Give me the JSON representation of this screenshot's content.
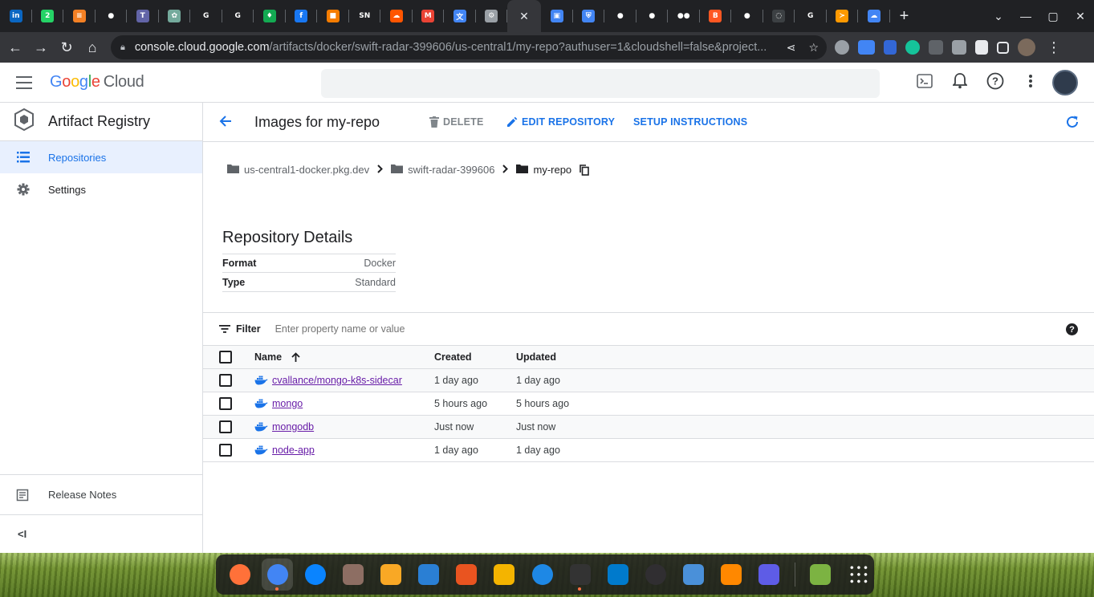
{
  "browser": {
    "tab_favicons": [
      {
        "name": "linkedin",
        "color": "#0a66c2",
        "glyph": "in"
      },
      {
        "name": "whatsapp",
        "color": "#25d366",
        "glyph": "2"
      },
      {
        "name": "stackoverflow",
        "color": "#f48024",
        "glyph": "≡"
      },
      {
        "name": "github",
        "color": "#ffffff",
        "glyph": "●"
      },
      {
        "name": "teams",
        "color": "#6264a7",
        "glyph": "T"
      },
      {
        "name": "chatgpt",
        "color": "#74aa9c",
        "glyph": "✿"
      },
      {
        "name": "google",
        "color": "#ffffff",
        "glyph": "G"
      },
      {
        "name": "google",
        "color": "#ffffff",
        "glyph": "G"
      },
      {
        "name": "mongodb",
        "color": "#13aa52",
        "glyph": "♦"
      },
      {
        "name": "facebook",
        "color": "#1877f2",
        "glyph": "f"
      },
      {
        "name": "package",
        "color": "#f57c00",
        "glyph": "■"
      },
      {
        "name": "sn",
        "color": "#ffffff",
        "glyph": "SN"
      },
      {
        "name": "soundcloud",
        "color": "#ff5500",
        "glyph": "☁"
      },
      {
        "name": "gmail",
        "color": "#ea4335",
        "glyph": "M"
      },
      {
        "name": "translate",
        "color": "#4285f4",
        "glyph": "文"
      },
      {
        "name": "settings",
        "color": "#9aa0a6",
        "glyph": "⚙"
      }
    ],
    "tab_favicons_right": [
      {
        "name": "chip",
        "color": "#4285f4",
        "glyph": "▣"
      },
      {
        "name": "shield",
        "color": "#4285f4",
        "glyph": "⛨"
      },
      {
        "name": "github",
        "color": "#ffffff",
        "glyph": "●"
      },
      {
        "name": "github",
        "color": "#ffffff",
        "glyph": "●"
      },
      {
        "name": "medium",
        "color": "#ffffff",
        "glyph": "●●"
      },
      {
        "name": "blogger",
        "color": "#ff5722",
        "glyph": "B"
      },
      {
        "name": "github",
        "color": "#ffffff",
        "glyph": "●"
      },
      {
        "name": "dark",
        "color": "#3c4043",
        "glyph": "◌"
      },
      {
        "name": "google",
        "color": "#ffffff",
        "glyph": "G"
      },
      {
        "name": "aws",
        "color": "#ff9900",
        "glyph": "≻"
      },
      {
        "name": "gcloud",
        "color": "#4285f4",
        "glyph": "☁"
      }
    ],
    "active_tab_close": "✕",
    "url_domain": "console.cloud.google.com",
    "url_path": "/artifacts/docker/swift-radar-399606/us-central1/my-repo?authuser=1&cloudshell=false&project..."
  },
  "header": {
    "logo_letters": [
      "G",
      "o",
      "o",
      "g",
      "l",
      "e"
    ],
    "logo_suffix": "Cloud"
  },
  "sidenav": {
    "product": "Artifact Registry",
    "items": [
      {
        "label": "Repositories",
        "active": true
      },
      {
        "label": "Settings",
        "active": false
      }
    ],
    "release_notes": "Release Notes",
    "collapse": "<I"
  },
  "page": {
    "title": "Images for my-repo",
    "actions": {
      "delete": "DELETE",
      "edit": "EDIT REPOSITORY",
      "setup": "SETUP INSTRUCTIONS"
    },
    "breadcrumb": [
      {
        "label": "us-central1-docker.pkg.dev"
      },
      {
        "label": "swift-radar-399606"
      },
      {
        "label": "my-repo"
      }
    ],
    "details": {
      "title": "Repository Details",
      "rows": [
        {
          "key": "Format",
          "value": "Docker"
        },
        {
          "key": "Type",
          "value": "Standard"
        }
      ]
    },
    "filter": {
      "label": "Filter",
      "placeholder": "Enter property name or value"
    },
    "table": {
      "headers": {
        "name": "Name",
        "created": "Created",
        "updated": "Updated"
      },
      "sort_indicator": "↑",
      "rows": [
        {
          "name": "cvallance/mongo-k8s-sidecar",
          "created": "1 day ago",
          "updated": "1 day ago"
        },
        {
          "name": "mongo",
          "created": "5 hours ago",
          "updated": "5 hours ago"
        },
        {
          "name": "mongodb",
          "created": "Just now",
          "updated": "Just now"
        },
        {
          "name": "node-app",
          "created": "1 day ago",
          "updated": "1 day ago"
        }
      ]
    }
  },
  "dock": {
    "apps": [
      {
        "name": "firefox",
        "color": "#ff7139"
      },
      {
        "name": "chrome",
        "color": "#4285f4",
        "active": true
      },
      {
        "name": "thunderbird",
        "color": "#0a84ff"
      },
      {
        "name": "files",
        "color": "#8d6e63"
      },
      {
        "name": "rhythmbox",
        "color": "#f9a825"
      },
      {
        "name": "libreoffice-writer",
        "color": "#2a7fd4"
      },
      {
        "name": "app-center",
        "color": "#e95420"
      },
      {
        "name": "yed",
        "color": "#f4b400"
      },
      {
        "name": "help",
        "color": "#1e88e5"
      },
      {
        "name": "terminal",
        "color": "#333333",
        "active": true
      },
      {
        "name": "vscode",
        "color": "#007acc"
      },
      {
        "name": "obs",
        "color": "#302e31"
      },
      {
        "name": "flatpak",
        "color": "#4a90d9"
      },
      {
        "name": "vlc",
        "color": "#ff8800"
      },
      {
        "name": "text-editor",
        "color": "#5e5ce6"
      },
      {
        "name": "trash",
        "color": "#7cb342"
      },
      {
        "name": "show-apps",
        "color": "#ffffff"
      }
    ]
  }
}
